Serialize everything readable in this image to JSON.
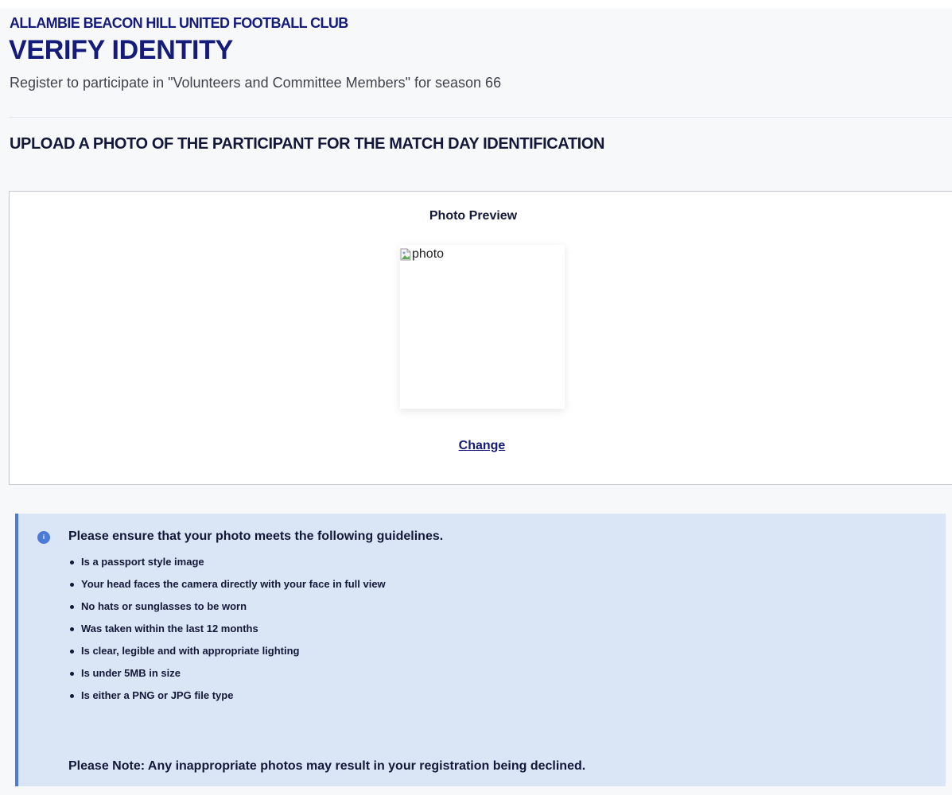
{
  "header": {
    "club_name": "ALLAMBIE BEACON HILL UNITED FOOTBALL CLUB",
    "title": "VERIFY IDENTITY",
    "subtitle": "Register to participate in \"Volunteers and Committee Members\" for season 66"
  },
  "upload_section": {
    "heading": "UPLOAD A PHOTO OF THE PARTICIPANT FOR THE MATCH DAY IDENTIFICATION",
    "preview_label": "Photo Preview",
    "image_alt": "photo",
    "change_label": "Change"
  },
  "guidelines": {
    "icon": "info-icon",
    "icon_glyph": "i",
    "heading": "Please ensure that your photo meets the following guidelines.",
    "items": [
      "Is a passport style image",
      "Your head faces the camera directly with your face in full view",
      "No hats or sunglasses to be worn",
      "Was taken within the last 12 months",
      "Is clear, legible and with appropriate lighting",
      "Is under 5MB in size",
      "Is either a PNG or JPG file type"
    ],
    "note": "Please Note: Any inappropriate photos may result in your registration being declined."
  },
  "colors": {
    "brand_navy": "#141b7a",
    "info_background": "#dae5f5",
    "info_accent": "#4a7bd8"
  }
}
